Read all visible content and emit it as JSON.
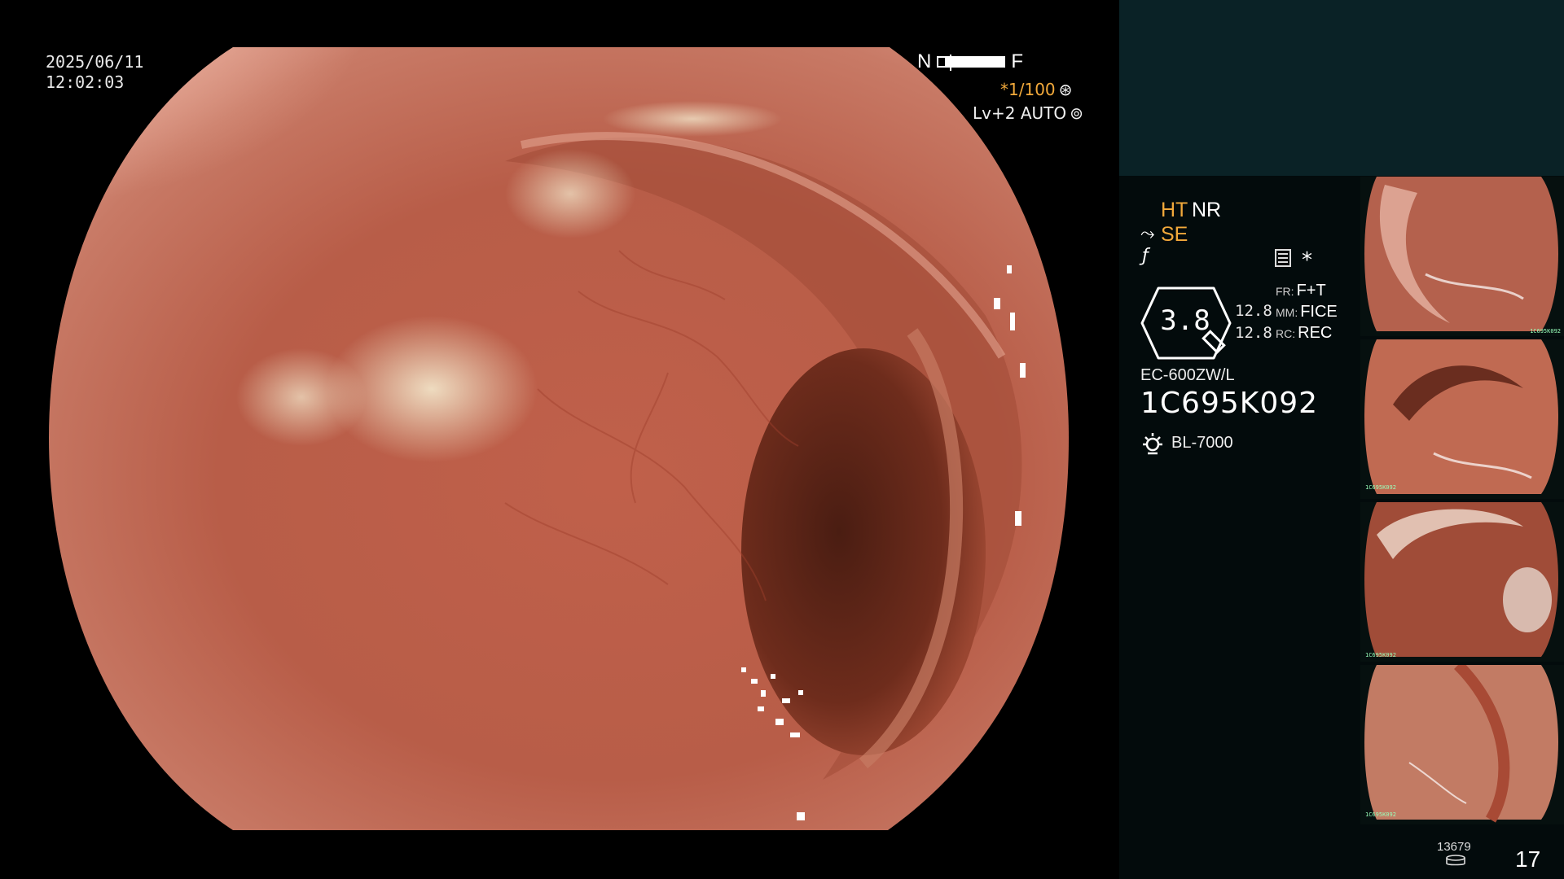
{
  "overlay": {
    "date": "2025/06/11",
    "time": "12:02:03",
    "near_label": "N",
    "far_label": "F",
    "focus_position": 0.9,
    "shutter": "*1/100",
    "shutter_icon": "aperture-icon",
    "iris": "Lv+2 AUTO",
    "iris_icon": "iris-icon"
  },
  "panel": {
    "ht": "HT",
    "nr": "NR",
    "se": "SE",
    "star": "*",
    "zoom": "3.8",
    "ratio_a": "12.8",
    "ratio_b": "12.8",
    "fr_key": "FR:",
    "fr_val": "F+T",
    "mm_key": "MM:",
    "mm_val": "FICE",
    "rc_key": "RC:",
    "rc_val": "REC",
    "scope_model": "EC-600ZW/L",
    "scope_serial": "1C695K092",
    "light_source": "BL-7000",
    "image_count": "13679",
    "page": "17",
    "colors": {
      "accent_orange": "#f2a93b",
      "panel_top": "#0a2226",
      "panel_bg": "#030b0c"
    }
  },
  "thumbnails": [
    {
      "serial": "1C695K092"
    },
    {
      "serial": "1C695K092"
    },
    {
      "serial": "1C695K092"
    },
    {
      "serial": "1C695K092"
    }
  ]
}
